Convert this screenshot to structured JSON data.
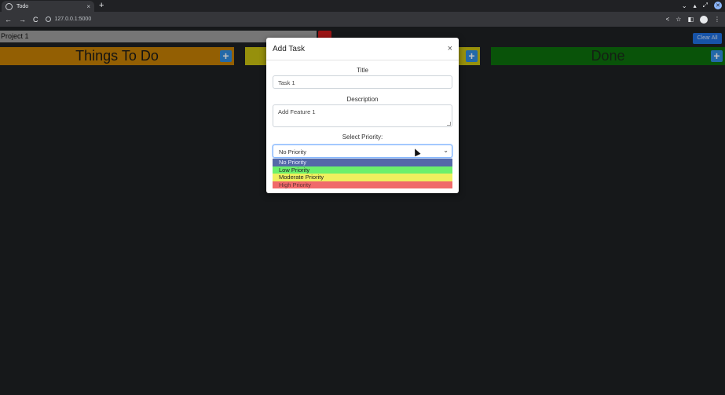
{
  "browser": {
    "tab_title": "Todo",
    "tab_close": "×",
    "new_tab": "+",
    "url": "127.0.0.1:5000",
    "back": "←",
    "forward": "→",
    "reload": "C"
  },
  "app": {
    "project_name": "Project 1",
    "clear_all_label": "Clear All",
    "columns": [
      {
        "title": "Things To Do",
        "color": "#c47f05"
      },
      {
        "title": "",
        "color": "#c8c011"
      },
      {
        "title": "Done",
        "color": "#0d6f0d"
      }
    ],
    "add_symbol": "+"
  },
  "modal": {
    "title": "Add Task",
    "close_symbol": "×",
    "title_label": "Title",
    "title_value": "Task 1",
    "description_label": "Description",
    "description_value": "Add Feature 1",
    "priority_label": "Select Priority:",
    "priority_selected": "No Priority",
    "priority_options": [
      {
        "label": "No Priority",
        "color": "#5468a8"
      },
      {
        "label": "Low Priority",
        "color": "#6cf06c"
      },
      {
        "label": "Moderate Priority",
        "color": "#eef05e"
      },
      {
        "label": "High Priority",
        "color": "#f06a6a"
      }
    ]
  }
}
